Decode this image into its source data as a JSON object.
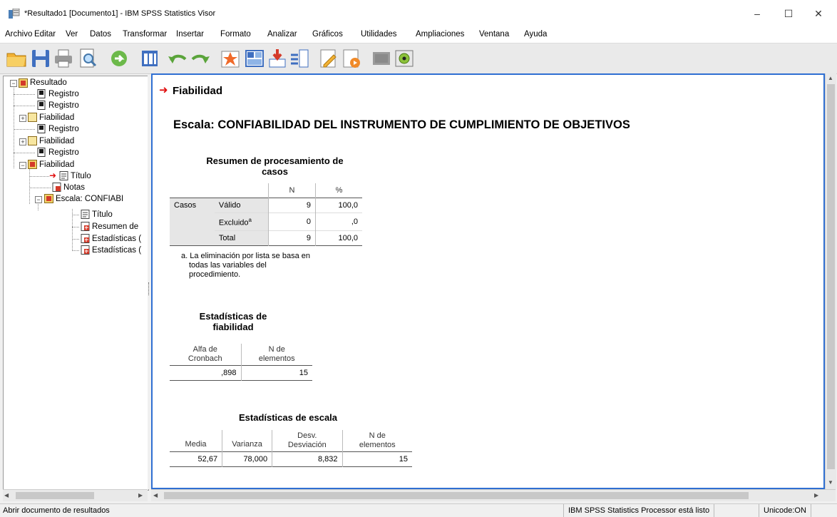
{
  "window": {
    "title": "*Resultado1 [Documento1] - IBM SPSS Statistics Visor",
    "minimize": "–",
    "maximize": "☐",
    "close": "✕"
  },
  "menu": [
    "Archivo",
    "Editar",
    "Ver",
    "Datos",
    "Transformar",
    "Insertar",
    "Formato",
    "Analizar",
    "Gráficos",
    "Utilidades",
    "Ampliaciones",
    "Ventana",
    "Ayuda"
  ],
  "toolbar": [
    "open-icon",
    "save-icon",
    "print-icon",
    "print-preview-icon",
    "export-icon",
    "goto-data-icon",
    "undo-icon",
    "redo-icon",
    "goto-case-icon",
    "goto-variable-icon",
    "insert-cases-icon",
    "insert-variable-icon",
    "designate-window-icon",
    "script-icon",
    "disabled-icon",
    "add-output-icon"
  ],
  "outline": [
    {
      "label": "Resultado"
    },
    {
      "label": "Registro"
    },
    {
      "label": "Registro"
    },
    {
      "label": "Fiabilidad"
    },
    {
      "label": "Registro"
    },
    {
      "label": "Fiabilidad"
    },
    {
      "label": "Registro"
    },
    {
      "label": "Fiabilidad"
    },
    {
      "label": "Título"
    },
    {
      "label": "Notas"
    },
    {
      "label": "Escala: CONFIABI"
    },
    {
      "label": "Título"
    },
    {
      "label": "Resumen de"
    },
    {
      "label": "Estadísticas ("
    },
    {
      "label": "Estadísticas ("
    }
  ],
  "output": {
    "heading": "Fiabilidad",
    "scale_title": "Escala: CONFIABILIDAD DEL INSTRUMENTO DE CUMPLIMIENTO DE OBJETIVOS",
    "case_summary": {
      "title_line1": "Resumen de procesamiento de",
      "title_line2": "casos",
      "col_n": "N",
      "col_pct": "%",
      "group": "Casos",
      "rows": [
        {
          "label": "Válido",
          "n": "9",
          "pct": "100,0"
        },
        {
          "label": "Excluido",
          "sup": "a",
          "n": "0",
          "pct": ",0"
        },
        {
          "label": "Total",
          "n": "9",
          "pct": "100,0"
        }
      ],
      "footnote_line1": "a. La eliminación por lista se basa en",
      "footnote_line2": "todas las variables del",
      "footnote_line3": "procedimiento."
    },
    "reliability": {
      "title_line1": "Estadísticas de",
      "title_line2": "fiabilidad",
      "col1_line1": "Alfa de",
      "col1_line2": "Cronbach",
      "col2_line1": "N de",
      "col2_line2": "elementos",
      "alpha": ",898",
      "n_items": "15"
    },
    "scale_stats": {
      "title": "Estadísticas de escala",
      "col_media": "Media",
      "col_varianza": "Varianza",
      "col_desv_line1": "Desv.",
      "col_desv_line2": "Desviación",
      "col_n_line1": "N de",
      "col_n_line2": "elementos",
      "media": "52,67",
      "varianza": "78,000",
      "desv": "8,832",
      "n": "15"
    }
  },
  "status": {
    "left": "Abrir documento de resultados",
    "processor": "IBM SPSS Statistics Processor está listo",
    "unicode": "Unicode:ON"
  }
}
